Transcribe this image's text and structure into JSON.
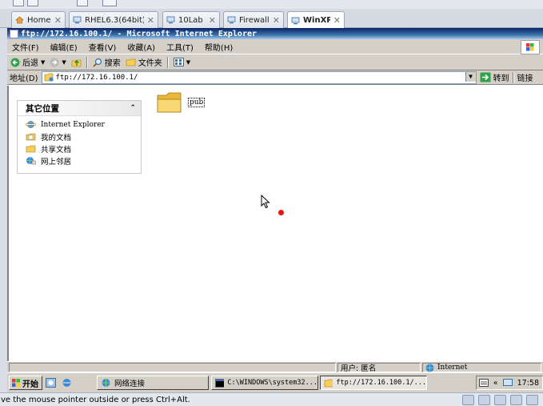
{
  "host": {
    "tabs": [
      {
        "label": "Home",
        "icon": "home-icon"
      },
      {
        "label": "RHEL6.3(64bit)",
        "icon": "vm-icon"
      },
      {
        "label": "10Lab",
        "icon": "vm-icon"
      },
      {
        "label": "Firewall",
        "icon": "vm-icon"
      },
      {
        "label": "WinXP",
        "icon": "vm-icon",
        "active": true
      }
    ],
    "close_glyph": "✕",
    "status_text": "ve the mouse pointer outside or press Ctrl+Alt."
  },
  "ie": {
    "title": "ftp://172.16.100.1/ - Microsoft Internet Explorer",
    "caption_buttons": [
      "_",
      "□",
      "✕"
    ],
    "menu": [
      "文件(F)",
      "编辑(E)",
      "查看(V)",
      "收藏(A)",
      "工具(T)",
      "帮助(H)"
    ],
    "toolbar": {
      "back": "后退",
      "search": "搜索",
      "folders": "文件夹"
    },
    "address": {
      "label": "地址(D)",
      "value": "ftp://172.16.100.1/",
      "go": "转到",
      "links": "链接"
    },
    "panel": {
      "title": "其它位置",
      "items": [
        {
          "label": "Internet Explorer",
          "icon": "ie-icon"
        },
        {
          "label": "我的文档",
          "icon": "documents-icon"
        },
        {
          "label": "共享文档",
          "icon": "shared-folder-icon"
        },
        {
          "label": "网上邻居",
          "icon": "network-icon"
        }
      ]
    },
    "folder": {
      "label": "pub"
    },
    "status": {
      "user": "用户: 匿名",
      "zone": "Internet"
    }
  },
  "taskbar": {
    "start": "开始",
    "tasks": [
      {
        "label": "网络连接",
        "icon": "network-connections-icon"
      },
      {
        "label": "C:\\WINDOWS\\system32...",
        "icon": "cmd-icon"
      },
      {
        "label": "ftp://172.16.100.1/...",
        "icon": "ie-icon",
        "active": true
      }
    ],
    "clock": "17:58"
  },
  "colors": {
    "titlebar": "#0a246a",
    "red_dot": "#e8141b",
    "folder": "#f5cf5a"
  }
}
